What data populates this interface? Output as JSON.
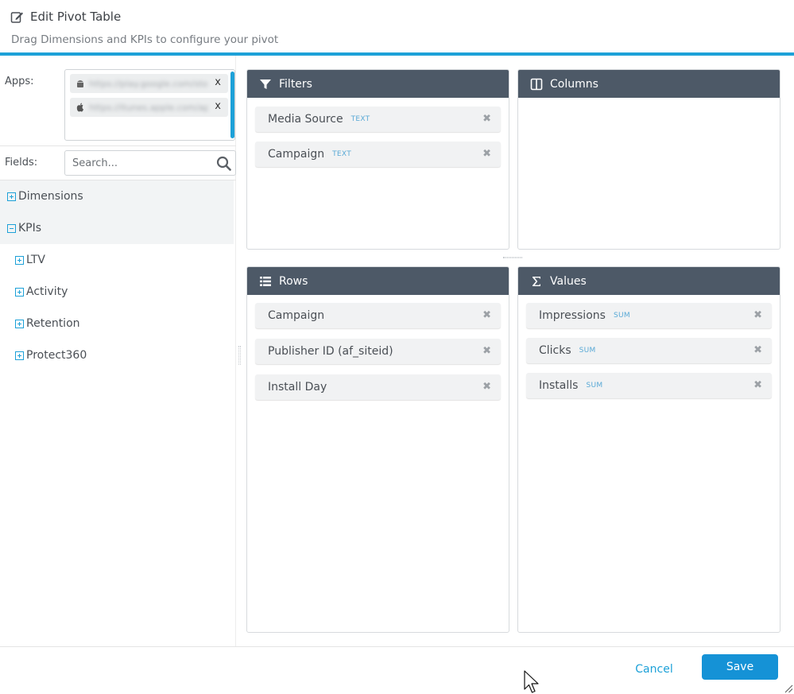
{
  "header": {
    "title": "Edit Pivot Table",
    "subtitle": "Drag Dimensions and KPIs to configure your pivot",
    "icon": "edit-icon"
  },
  "sidebar": {
    "apps_label": "Apps:",
    "apps": [
      {
        "platform": "android-icon",
        "name": "https://play.google.com/store",
        "remove": "x"
      },
      {
        "platform": "apple-icon",
        "name": "https://itunes.apple.com/app",
        "remove": "x"
      }
    ],
    "fields_label": "Fields:",
    "search_placeholder": "Search...",
    "tree": [
      {
        "label": "Dimensions",
        "expanded": false
      },
      {
        "label": "KPIs",
        "expanded": true
      },
      {
        "label": "LTV",
        "expanded": false
      },
      {
        "label": "Activity",
        "expanded": false
      },
      {
        "label": "Retention",
        "expanded": false
      },
      {
        "label": "Protect360",
        "expanded": false
      }
    ]
  },
  "zones": {
    "filters": {
      "title": "Filters",
      "icon": "filter-icon",
      "items": [
        {
          "name": "Media Source",
          "tag": "TEXT"
        },
        {
          "name": "Campaign",
          "tag": "TEXT"
        }
      ]
    },
    "columns": {
      "title": "Columns",
      "icon": "columns-icon",
      "items": []
    },
    "rows": {
      "title": "Rows",
      "icon": "list-icon",
      "items": [
        {
          "name": "Campaign",
          "tag": ""
        },
        {
          "name": "Publisher ID (af_siteid)",
          "tag": ""
        },
        {
          "name": "Install Day",
          "tag": ""
        }
      ]
    },
    "values": {
      "title": "Values",
      "icon": "sigma-icon",
      "items": [
        {
          "name": "Impressions",
          "tag": "SUM"
        },
        {
          "name": "Clicks",
          "tag": "SUM"
        },
        {
          "name": "Installs",
          "tag": "SUM"
        }
      ]
    }
  },
  "footer": {
    "cancel_label": "Cancel",
    "save_label": "Save"
  },
  "colors": {
    "accent": "#1da1d8",
    "zone_header": "#4d5967",
    "save_button": "#1592d6",
    "tag": "#59a9d6"
  }
}
